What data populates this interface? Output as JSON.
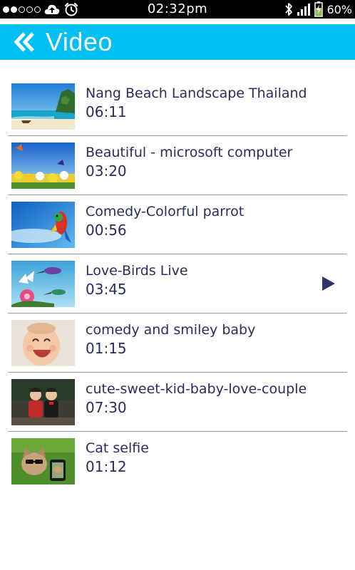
{
  "status_bar": {
    "time": "02:32pm",
    "battery": "60%"
  },
  "header": {
    "title": "Video",
    "back_icon": "double-chevron-left-icon"
  },
  "colors": {
    "header_bg": "#00bff3",
    "text": "#2a2c5e",
    "play_icon": "#2f3568"
  },
  "videos": [
    {
      "title": "Nang Beach Landscape Thailand",
      "duration": "06:11",
      "thumbnail": "beach-thumbnail"
    },
    {
      "title": "Beautiful - microsoft computer",
      "duration": "03:20",
      "thumbnail": "flowers-thumbnail"
    },
    {
      "title": "Comedy-Colorful parrot",
      "duration": "00:56",
      "thumbnail": "parrot-thumbnail"
    },
    {
      "title": "Love-Birds Live",
      "duration": "03:45",
      "thumbnail": "hummingbird-thumbnail",
      "playing": true
    },
    {
      "title": "comedy and smiley baby",
      "duration": "01:15",
      "thumbnail": "baby-thumbnail"
    },
    {
      "title": "cute-sweet-kid-baby-love-couple",
      "duration": "07:30",
      "thumbnail": "kids-thumbnail"
    },
    {
      "title": "Cat selfie",
      "duration": "01:12",
      "thumbnail": "cat-thumbnail"
    }
  ]
}
